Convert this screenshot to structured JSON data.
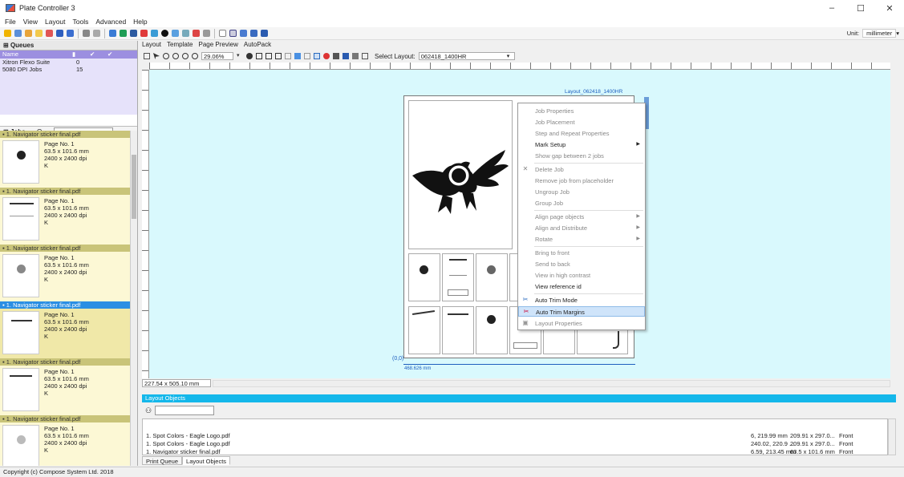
{
  "window": {
    "title": "Plate Controller 3",
    "controls": [
      "–",
      "☐",
      "✕"
    ]
  },
  "menu": [
    "File",
    "View",
    "Layout",
    "Tools",
    "Advanced",
    "Help"
  ],
  "toolbar": {
    "unit_label": "Unit:",
    "unit_value": "millimeter"
  },
  "queues": {
    "header": "Queues",
    "columns": [
      "Name",
      "",
      "",
      ""
    ],
    "rows": [
      {
        "name": "Xitron Flexo Suite",
        "count": "0"
      },
      {
        "name": "5080 DPI Jobs",
        "count": "15"
      }
    ]
  },
  "jobs": {
    "header": "Jobs",
    "items": [
      {
        "title": "1. Navigator sticker final.pdf",
        "page": "Page No. 1",
        "size": "63.5 x 101.6 mm",
        "dpi": "2400 x 2400 dpi",
        "color": "K",
        "selected": false
      },
      {
        "title": "1. Navigator sticker final.pdf",
        "page": "Page No. 1",
        "size": "63.5 x 101.6 mm",
        "dpi": "2400 x 2400 dpi",
        "color": "K",
        "selected": false
      },
      {
        "title": "1. Navigator sticker final.pdf",
        "page": "Page No. 1",
        "size": "63.5 x 101.6 mm",
        "dpi": "2400 x 2400 dpi",
        "color": "K",
        "selected": false
      },
      {
        "title": "1. Navigator sticker final.pdf",
        "page": "Page No. 1",
        "size": "63.5 x 101.6 mm",
        "dpi": "2400 x 2400 dpi",
        "color": "K",
        "selected": true
      },
      {
        "title": "1. Navigator sticker final.pdf",
        "page": "Page No. 1",
        "size": "63.5 x 101.6 mm",
        "dpi": "2400 x 2400 dpi",
        "color": "K",
        "selected": false
      },
      {
        "title": "1. Navigator sticker final.pdf",
        "page": "Page No. 1",
        "size": "63.5 x 101.6 mm",
        "dpi": "2400 x 2400 dpi",
        "color": "K",
        "selected": false
      }
    ]
  },
  "tabs": [
    "Layout",
    "Template",
    "Page Preview",
    "AutoPack"
  ],
  "layout_toolbar": {
    "zoom": "29.06%",
    "select_label": "Select Layout:",
    "select_value": "062418_1400HR"
  },
  "canvas": {
    "layout_label": "Layout_062418_1400HR",
    "origin": "(0,0)",
    "width_dim": "468.626 mm",
    "coords": "227.54 x 505.10 mm"
  },
  "context_menu": {
    "items": [
      {
        "label": "Job Properties",
        "enabled": false
      },
      {
        "label": "Job Placement",
        "enabled": false
      },
      {
        "label": "Step and Repeat  Properties",
        "enabled": false
      },
      {
        "label": "Mark Setup",
        "enabled": true,
        "submenu": true
      },
      {
        "label": "Show gap between 2 jobs",
        "enabled": false
      },
      {
        "label": "Delete Job",
        "enabled": false,
        "icon": "delete-icon"
      },
      {
        "label": "Remove job from placeholder",
        "enabled": false
      },
      {
        "label": "Ungroup Job",
        "enabled": false
      },
      {
        "label": "Group Job",
        "enabled": false
      },
      {
        "label": "Align page objects",
        "enabled": false,
        "submenu": true
      },
      {
        "label": "Align and Distribute",
        "enabled": false,
        "submenu": true
      },
      {
        "label": "Rotate",
        "enabled": false,
        "submenu": true
      },
      {
        "label": "Bring to front",
        "enabled": false
      },
      {
        "label": "Send to back",
        "enabled": false
      },
      {
        "label": "View in high contrast",
        "enabled": false
      },
      {
        "label": "View reference id",
        "enabled": true
      },
      {
        "label": "Auto Trim Mode",
        "enabled": true,
        "icon": "auto-trim-mode-icon"
      },
      {
        "label": "Auto Trim Margins",
        "enabled": true,
        "icon": "auto-trim-margins-icon",
        "highlighted": true
      },
      {
        "label": "Layout Properties",
        "enabled": false,
        "icon": "layout-properties-icon"
      }
    ]
  },
  "layout_objects": {
    "header": "Layout Objects",
    "rows": [
      {
        "name": "1. Spot Colors - Eagle Logo.pdf",
        "pos": "6, 219.99 mm",
        "size": "209.91 x 297.0...",
        "side": "Front"
      },
      {
        "name": "1. Spot Colors - Eagle Logo.pdf",
        "pos": "240.02, 220.9 ...",
        "size": "209.91 x 297.0...",
        "side": "Front"
      },
      {
        "name": "1. Navigator sticker final.pdf",
        "pos": "6.59, 213.45 mm",
        "size": "63.5 x 101.6 mm",
        "side": "Front"
      }
    ]
  },
  "bottom_tabs": [
    "Print Queue",
    "Layout Objects"
  ],
  "status": "Copyright (c) Compose System Ltd. 2018"
}
